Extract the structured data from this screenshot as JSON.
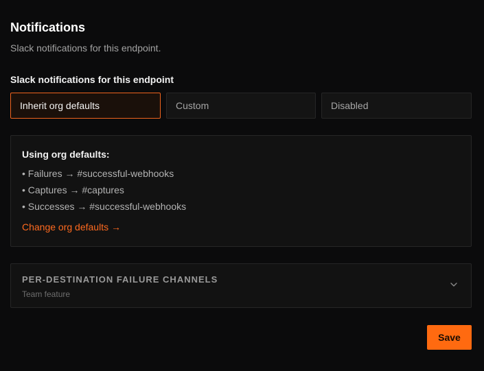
{
  "header": {
    "title": "Notifications",
    "subtitle": "Slack notifications for this endpoint."
  },
  "slack_setting": {
    "label": "Slack notifications for this endpoint",
    "options": [
      {
        "label": "Inherit org defaults",
        "selected": true
      },
      {
        "label": "Custom",
        "selected": false
      },
      {
        "label": "Disabled",
        "selected": false
      }
    ]
  },
  "org_defaults": {
    "title": "Using org defaults:",
    "items": [
      "• Failures → #successful-webhooks",
      "• Captures → #captures",
      "• Successes → #successful-webhooks"
    ],
    "change_link": "Change org defaults →"
  },
  "per_destination": {
    "title": "PER-DESTINATION FAILURE CHANNELS",
    "subtitle": "Team feature",
    "icon": "chevron-down-icon"
  },
  "footer": {
    "save_label": "Save"
  },
  "colors": {
    "accent": "#ff6a10",
    "background": "#0b0b0c",
    "panel": "#121212",
    "border": "#262626"
  }
}
